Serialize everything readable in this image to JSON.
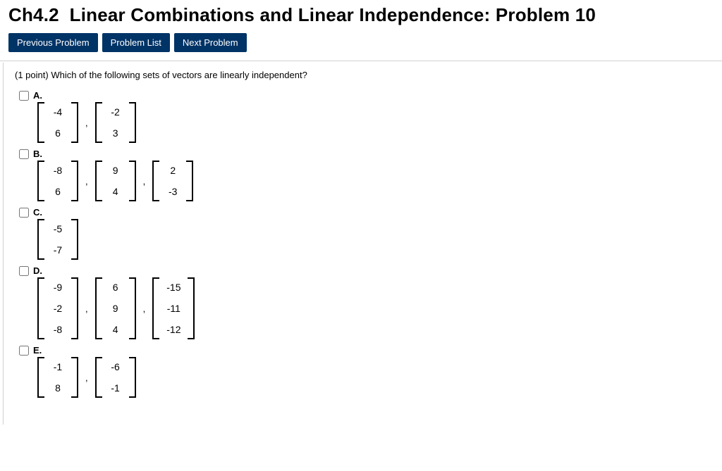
{
  "title": "Ch4.2  Linear Combinations and Linear Independence: Problem 10",
  "nav": {
    "prev": "Previous Problem",
    "list": "Problem List",
    "next": "Next Problem"
  },
  "question_prefix": "(1 point)",
  "question_body": " Which of the following sets of vectors are linearly independent?",
  "options": [
    {
      "label": "A.",
      "vectors": [
        [
          "-4",
          "6"
        ],
        [
          "-2",
          "3"
        ]
      ]
    },
    {
      "label": "B.",
      "vectors": [
        [
          "-8",
          "6"
        ],
        [
          "9",
          "4"
        ],
        [
          "2",
          "-3"
        ]
      ]
    },
    {
      "label": "C.",
      "vectors": [
        [
          "-5",
          "-7"
        ]
      ]
    },
    {
      "label": "D.",
      "vectors": [
        [
          "-9",
          "-2",
          "-8"
        ],
        [
          "6",
          "9",
          "4"
        ],
        [
          "-15",
          "-11",
          "-12"
        ]
      ]
    },
    {
      "label": "E.",
      "vectors": [
        [
          "-1",
          "8"
        ],
        [
          "-6",
          "-1"
        ]
      ]
    }
  ]
}
